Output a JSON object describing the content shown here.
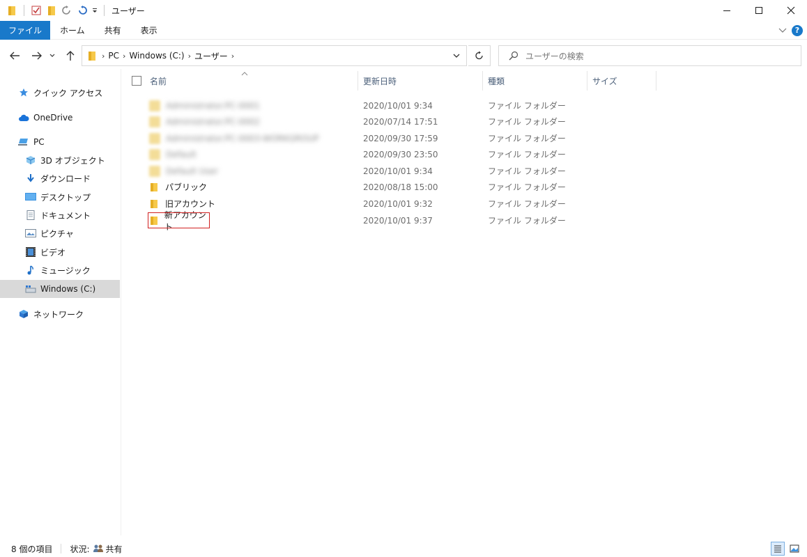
{
  "window": {
    "title": "ユーザー"
  },
  "ribbon": {
    "tabs": [
      {
        "label": "ファイル"
      },
      {
        "label": "ホーム"
      },
      {
        "label": "共有"
      },
      {
        "label": "表示"
      }
    ],
    "help_label": "?"
  },
  "address": {
    "crumbs": [
      "PC",
      "Windows (C:)",
      "ユーザー"
    ],
    "search_placeholder": "ユーザーの検索"
  },
  "sidebar": {
    "items": [
      {
        "label": "クイック アクセス",
        "icon": "star-icon"
      },
      {
        "label": "OneDrive",
        "icon": "cloud-icon"
      },
      {
        "label": "PC",
        "icon": "computer-icon"
      },
      {
        "label": "3D オブジェクト",
        "icon": "cube-icon"
      },
      {
        "label": "ダウンロード",
        "icon": "download-icon"
      },
      {
        "label": "デスクトップ",
        "icon": "desktop-icon"
      },
      {
        "label": "ドキュメント",
        "icon": "document-icon"
      },
      {
        "label": "ピクチャ",
        "icon": "picture-icon"
      },
      {
        "label": "ビデオ",
        "icon": "video-icon"
      },
      {
        "label": "ミュージック",
        "icon": "music-icon"
      },
      {
        "label": "Windows (C:)",
        "icon": "drive-icon",
        "selected": true
      },
      {
        "label": "ネットワーク",
        "icon": "network-icon"
      }
    ]
  },
  "columns": {
    "name": "名前",
    "modified": "更新日時",
    "type": "種類",
    "size": "サイズ"
  },
  "files": [
    {
      "name": "Administrator.PC-0001",
      "date": "2020/10/01 9:34",
      "type": "ファイル フォルダー",
      "blurred": true
    },
    {
      "name": "Administrator.PC-0002",
      "date": "2020/07/14 17:51",
      "type": "ファイル フォルダー",
      "blurred": true
    },
    {
      "name": "Administrator.PC-0003-WORKGROUP",
      "date": "2020/09/30 17:59",
      "type": "ファイル フォルダー",
      "blurred": true
    },
    {
      "name": "Default",
      "date": "2020/09/30 23:50",
      "type": "ファイル フォルダー",
      "blurred": true
    },
    {
      "name": "Default User",
      "date": "2020/10/01 9:34",
      "type": "ファイル フォルダー",
      "blurred": true
    },
    {
      "name": "パブリック",
      "date": "2020/08/18 15:00",
      "type": "ファイル フォルダー",
      "blurred": false
    },
    {
      "name": "旧アカウント",
      "date": "2020/10/01 9:32",
      "type": "ファイル フォルダー",
      "blurred": false
    },
    {
      "name": "新アカウント",
      "date": "2020/10/01 9:37",
      "type": "ファイル フォルダー",
      "blurred": false,
      "highlighted": true
    }
  ],
  "status": {
    "count": "8 個の項目",
    "state_label": "状況:",
    "state_value": "共有"
  },
  "colors": {
    "accent": "#1979ca",
    "folder": "#f5c518",
    "highlight_border": "#d02020"
  }
}
